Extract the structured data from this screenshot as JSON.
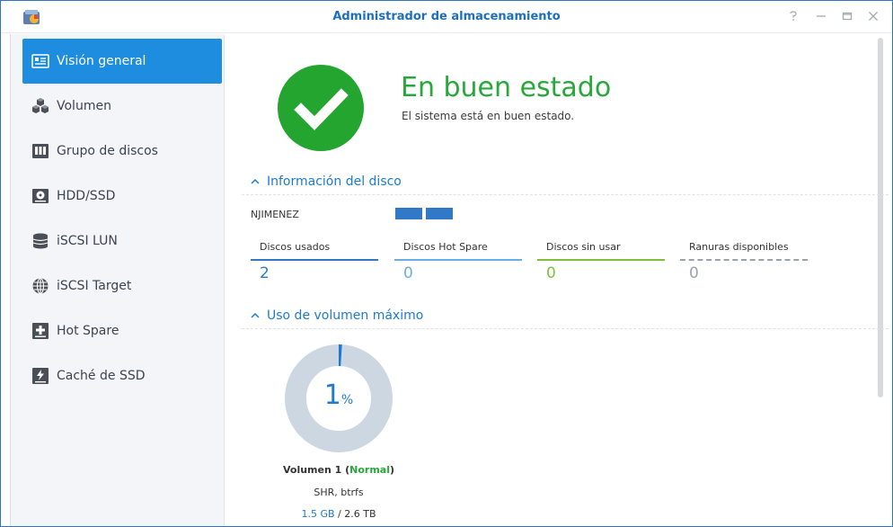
{
  "window": {
    "title": "Administrador de almacenamiento",
    "controls": [
      "help-icon",
      "minimize-icon",
      "maximize-icon",
      "close-icon"
    ]
  },
  "sidebar": {
    "items": [
      {
        "label": "Visión general",
        "icon": "overview-icon",
        "active": true
      },
      {
        "label": "Volumen",
        "icon": "volume-icon",
        "active": false
      },
      {
        "label": "Grupo de discos",
        "icon": "disk-group-icon",
        "active": false
      },
      {
        "label": "HDD/SSD",
        "icon": "hdd-icon",
        "active": false
      },
      {
        "label": "iSCSI LUN",
        "icon": "iscsi-lun-icon",
        "active": false
      },
      {
        "label": "iSCSI Target",
        "icon": "iscsi-target-icon",
        "active": false
      },
      {
        "label": "Hot Spare",
        "icon": "hot-spare-icon",
        "active": false
      },
      {
        "label": "Caché de SSD",
        "icon": "ssd-cache-icon",
        "active": false
      }
    ]
  },
  "status": {
    "title": "En buen estado",
    "subtitle": "El sistema está en buen estado.",
    "icon": "check-icon",
    "color": "#23a530"
  },
  "disk_info": {
    "header": "Información del disco",
    "server_name": "NJIMENEZ",
    "stats": [
      {
        "label": "Discos usados",
        "value": "2",
        "color": "#3179c6"
      },
      {
        "label": "Discos Hot Spare",
        "value": "0",
        "color": "#6aaee6"
      },
      {
        "label": "Discos sin usar",
        "value": "0",
        "color": "#7ec13b"
      },
      {
        "label": "Ranuras disponibles",
        "value": "0",
        "color": "#9aa3ad"
      }
    ]
  },
  "volume_usage": {
    "header": "Uso de volumen máximo",
    "percent_value": "1",
    "percent_sign": "%",
    "usage_fraction": 0.01,
    "volume_name": "Volumen 1",
    "volume_state_open": " (",
    "volume_state": "Normal",
    "volume_state_close": ")",
    "fs_type": "SHR, btrfs",
    "used": "1.5 GB",
    "separator": " / ",
    "total": "2.6 TB"
  },
  "colors": {
    "accent": "#1e8ddf",
    "ok_green": "#23a530",
    "link_blue": "#1d7ad0",
    "donut_track": "#cdd7e1"
  }
}
